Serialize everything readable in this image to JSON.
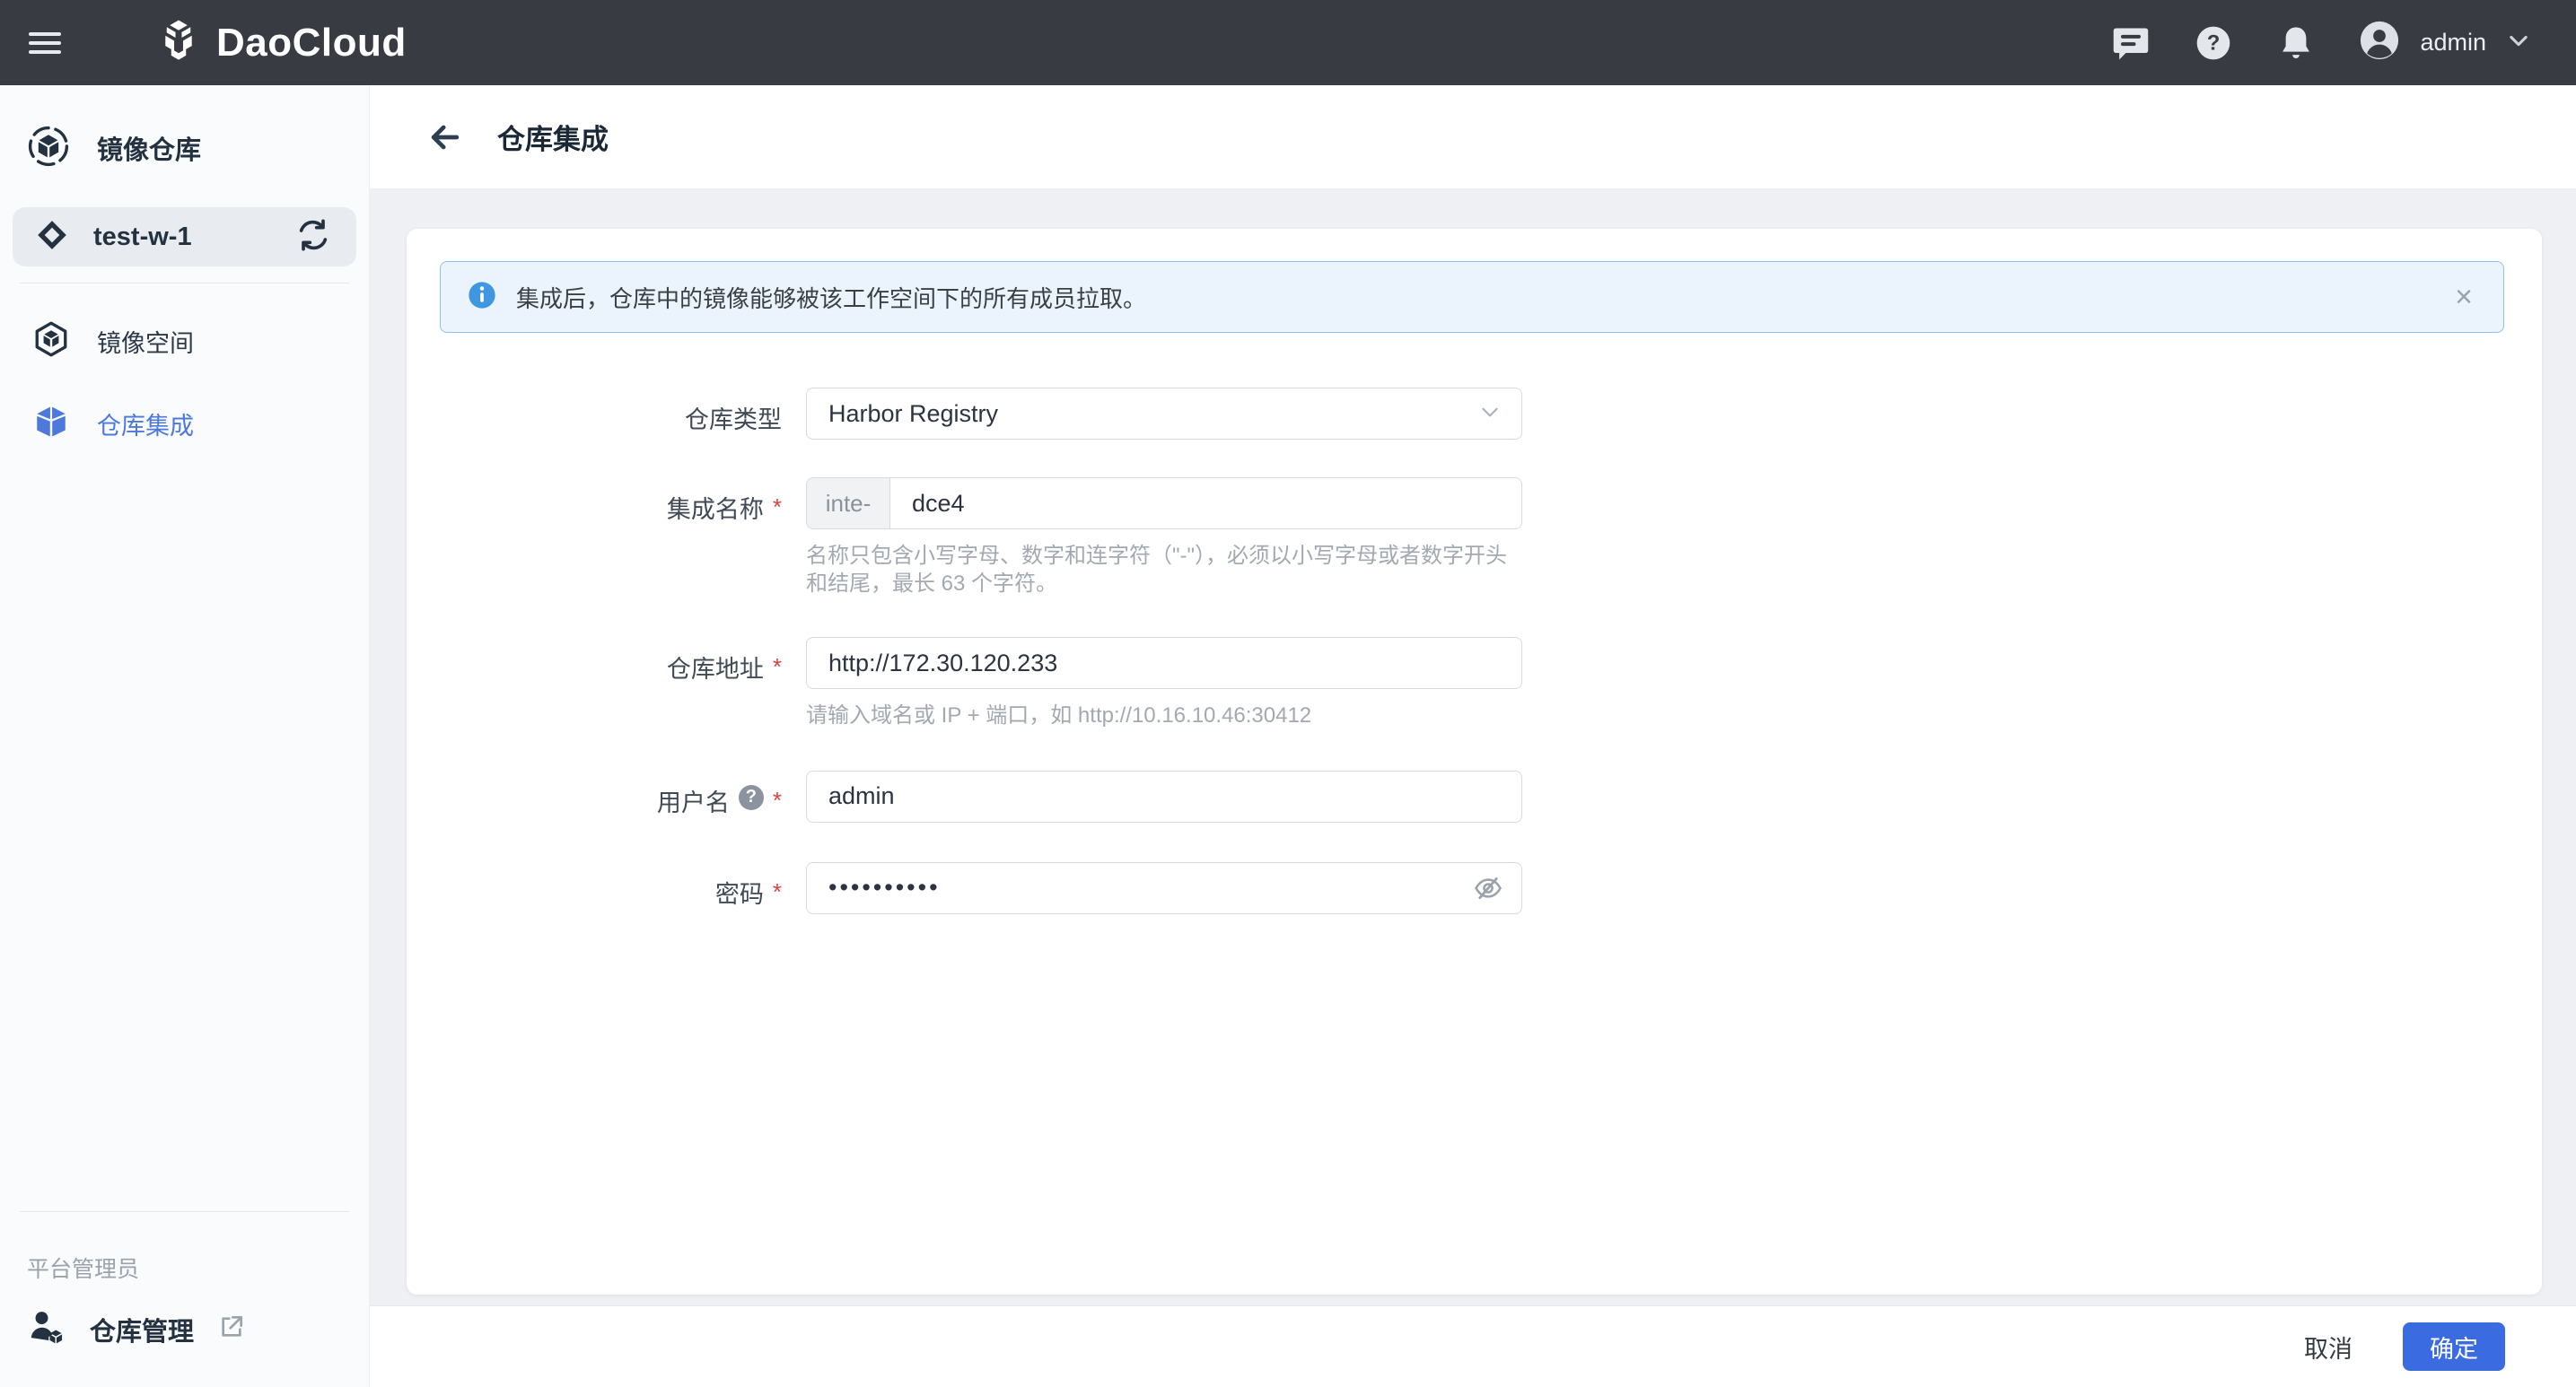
{
  "topnav": {
    "logo_text": "DaoCloud",
    "username": "admin"
  },
  "sidebar": {
    "header_label": "镜像仓库",
    "workspace": "test-w-1",
    "items": [
      {
        "label": "镜像空间",
        "active": false
      },
      {
        "label": "仓库集成",
        "active": true
      }
    ],
    "role_label": "平台管理员",
    "bottom_item_label": "仓库管理"
  },
  "page": {
    "title": "仓库集成"
  },
  "banner": {
    "text": "集成后，仓库中的镜像能够被该工作空间下的所有成员拉取。",
    "close_glyph": "×"
  },
  "form": {
    "repo_type": {
      "label": "仓库类型",
      "value": "Harbor Registry"
    },
    "integration_name": {
      "label": "集成名称",
      "required_mark": "*",
      "prefix": "inte-",
      "value": "dce4",
      "helper": "名称只包含小写字母、数字和连字符（\"-\"），必须以小写字母或者数字开头和结尾，最长 63 个字符。"
    },
    "repo_address": {
      "label": "仓库地址",
      "required_mark": "*",
      "value": "http://172.30.120.233",
      "helper": "请输入域名或 IP + 端口，如 http://10.16.10.46:30412"
    },
    "username": {
      "label": "用户名",
      "required_mark": "*",
      "help_glyph": "?",
      "value": "admin"
    },
    "password": {
      "label": "密码",
      "required_mark": "*",
      "masked_value": "••••••••••"
    }
  },
  "footer": {
    "cancel_label": "取消",
    "confirm_label": "确定"
  },
  "colors": {
    "nav_bg": "#383b42",
    "accent_blue": "#3b6be1",
    "active_link_blue": "#4d79dd",
    "banner_border": "#8ec2ec",
    "banner_bg": "#ebf4fc",
    "required_red": "#d8433f",
    "page_bg": "#eef0f3"
  }
}
